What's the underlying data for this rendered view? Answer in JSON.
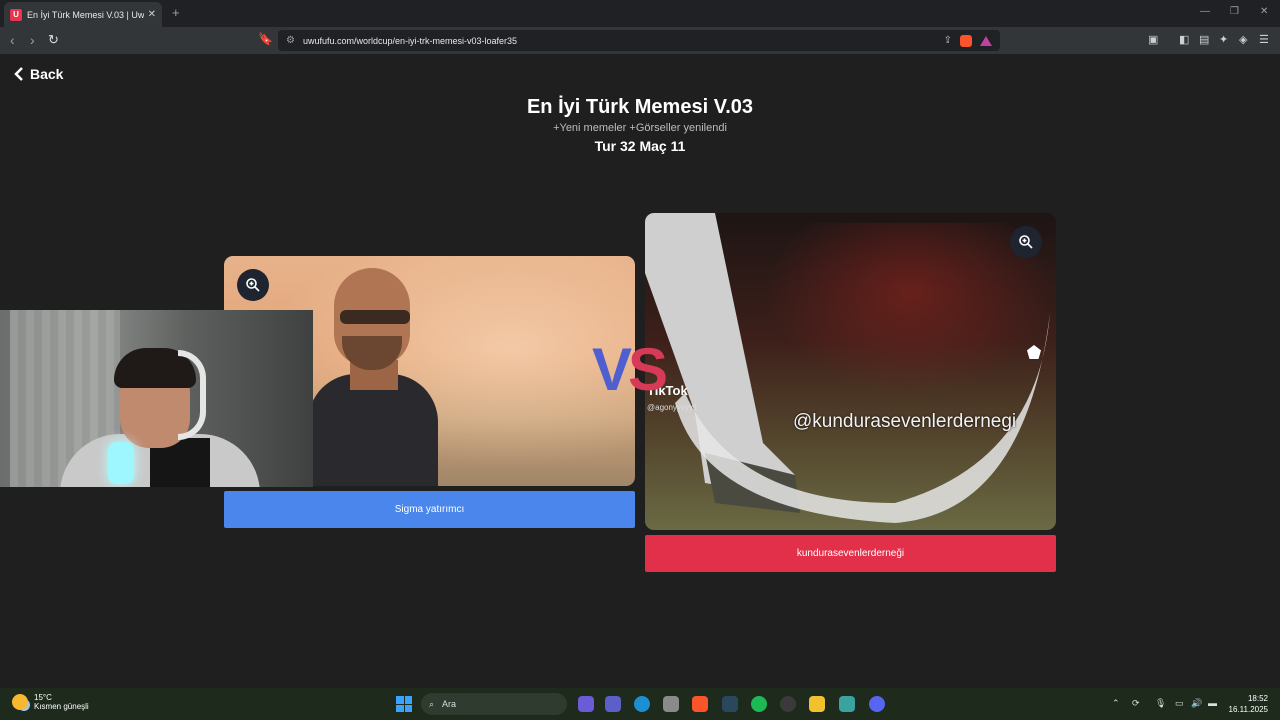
{
  "browser": {
    "tab_title": "En İyi Türk Memesi V.03 | UwUFu",
    "tab_favicon": "U",
    "url": "uwufufu.com/worldcup/en-iyi-trk-memesi-v03-loafer35"
  },
  "page": {
    "back_label": "Back",
    "title": "En İyi Türk Memesi V.03",
    "subtitle": "+Yeni memeler +Görseller yenilendi",
    "round": "Tur 32 Maç 11",
    "vs_v": "V",
    "vs_s": "S"
  },
  "left_option": {
    "label": "Sigma yatırımcı",
    "color": "#4a86ec"
  },
  "right_option": {
    "label": "kundurasevenlerderneği",
    "color": "#e2304a",
    "image_watermark": "@kundurasevenlerdernegi",
    "image_tiktok": "TikTok",
    "image_tiktok_user": "@agonyyyyy1"
  },
  "taskbar": {
    "weather_temp": "15°C",
    "weather_desc": "Kısmen güneşli",
    "search_placeholder": "Ara",
    "time": "18:52",
    "date": "16.11.2025"
  },
  "icons": [
    "back-chevron-icon",
    "zoom-in-icon",
    "search-icon",
    "windows-icon"
  ]
}
